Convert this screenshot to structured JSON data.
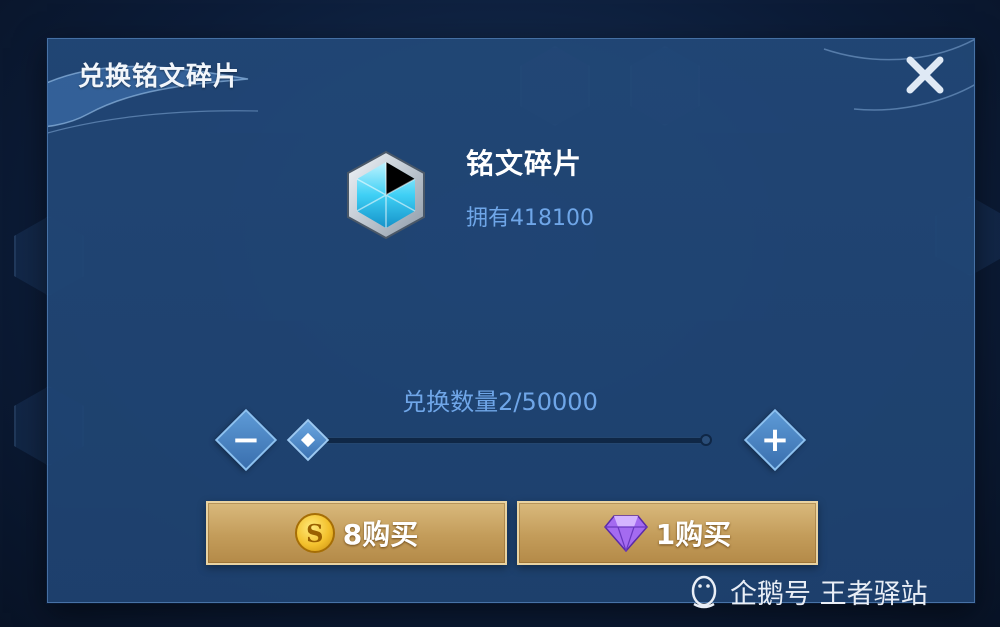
{
  "dialog": {
    "title": "兑换铭文碎片",
    "close_icon": "close-icon"
  },
  "item": {
    "name": "铭文碎片",
    "owned": "拥有418100",
    "icon": "hexagon-crystal-icon"
  },
  "exchange": {
    "quantity_label": "兑换数量2/50000",
    "current": 2,
    "max": 50000,
    "minus_symbol": "−",
    "plus_symbol": "+"
  },
  "buttons": {
    "gold_buy": {
      "label": "8购买",
      "icon": "gold-coin-icon",
      "coin_letter": "S"
    },
    "diamond_buy": {
      "label": "1购买",
      "icon": "purple-diamond-icon"
    }
  },
  "watermark": {
    "text": "企鹅号 王者驿站",
    "icon": "penguin-logo-icon"
  },
  "colors": {
    "panel": "#224878",
    "accent_text": "#6fa6e8",
    "gold_button": "#c39c5a"
  }
}
